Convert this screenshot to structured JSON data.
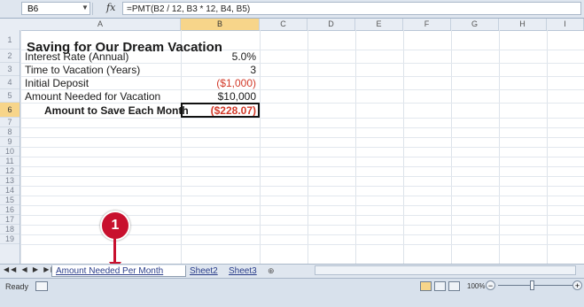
{
  "formula_bar": {
    "name_box": "B6",
    "fx_label": "fx",
    "formula": "=PMT(B2 / 12, B3 * 12, B4, B5)"
  },
  "columns": [
    "A",
    "B",
    "C",
    "D",
    "E",
    "F",
    "G",
    "H",
    "I"
  ],
  "rows": [
    "1",
    "2",
    "3",
    "4",
    "5",
    "6",
    "7",
    "8",
    "9",
    "10",
    "11",
    "12",
    "13",
    "14",
    "15",
    "16",
    "17",
    "18",
    "19"
  ],
  "sheet": {
    "title": "Saving for Our Dream Vacation",
    "labels": [
      "Interest Rate (Annual)",
      "Time to Vacation (Years)",
      "Initial Deposit",
      "Amount Needed for Vacation",
      "Amount to Save Each Month"
    ],
    "values": [
      "5.0%",
      "3",
      "($1,000)",
      "$10,000",
      "($228.07)"
    ]
  },
  "callout": "1",
  "tabs": [
    "Amount Needed Per Month",
    "Sheet2",
    "Sheet3"
  ],
  "status": {
    "ready": "Ready",
    "zoom": "100%",
    "zoom_value": 100
  },
  "colors": {
    "negative": "#d23a2a",
    "selected_header": "#f7d58a",
    "callout": "#c8102e"
  },
  "icons": [
    "fx-icon",
    "macro-record-icon",
    "normal-view-icon",
    "page-layout-icon",
    "page-break-icon",
    "zoom-minus-icon",
    "zoom-plus-icon",
    "insert-sheet-icon"
  ]
}
